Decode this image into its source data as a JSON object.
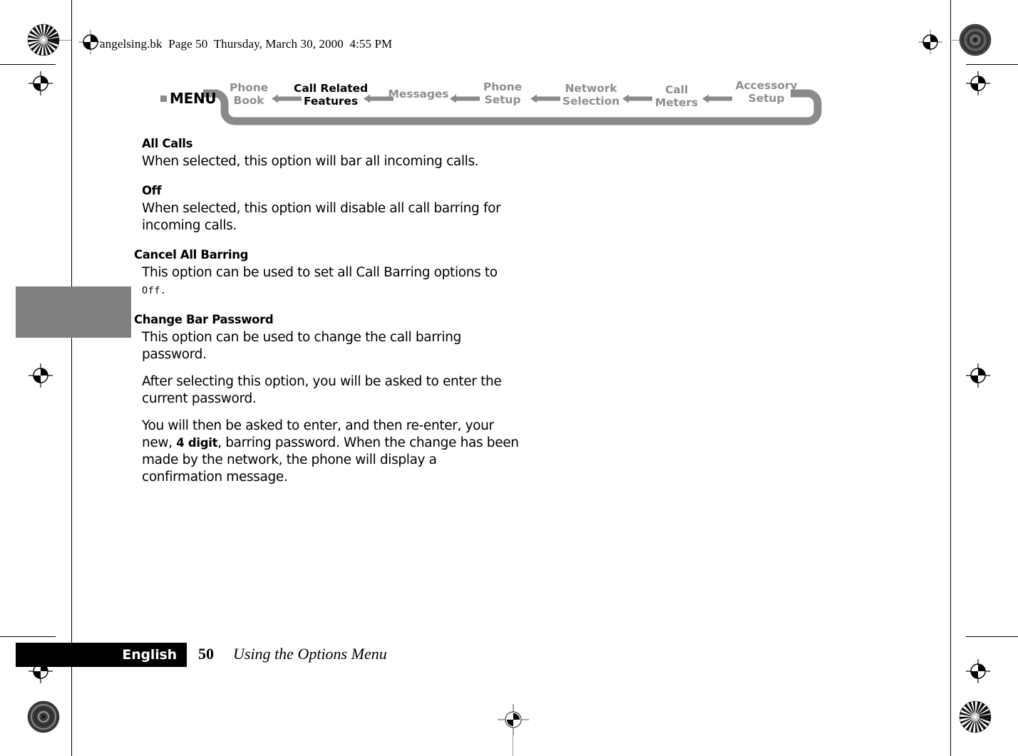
{
  "document": {
    "header_line": "angelsing.bk  Page 50  Thursday, March 30, 2000  4:55 PM"
  },
  "breadcrumb": {
    "menu_label": "MENU",
    "items": [
      {
        "line1": "Phone",
        "line2": "Book",
        "active": false
      },
      {
        "line1": "Call Related",
        "line2": "Features",
        "active": true
      },
      {
        "line1": "Messages",
        "line2": "",
        "active": false
      },
      {
        "line1": "Phone",
        "line2": "Setup",
        "active": false
      },
      {
        "line1": "Network",
        "line2": "Selection",
        "active": false
      },
      {
        "line1": "Call",
        "line2": "Meters",
        "active": false
      },
      {
        "line1": "Accessory",
        "line2": "Setup",
        "active": false
      }
    ]
  },
  "content": {
    "all_calls_heading": "All Calls",
    "all_calls_body": "When selected, this option will bar all incoming calls.",
    "off_heading": "Off",
    "off_body": "When selected, this option will disable all call barring for incoming calls.",
    "cancel_all_barring_heading": "Cancel All Barring",
    "cancel_all_barring_body_prefix": "This option can be used to set all Call Barring options to ",
    "cancel_all_barring_body_device": "Off",
    "cancel_all_barring_body_suffix": ".",
    "change_bar_password_heading": "Change Bar Password",
    "change_bar_password_body": "This option can be used to change the call barring password.",
    "change_bar_password_para2": "After selecting this option, you will be asked to enter the current password.",
    "change_bar_password_para3_prefix": "You will then be asked to enter, and then re-enter, your new, ",
    "change_bar_password_para3_bold": "4 digit",
    "change_bar_password_para3_suffix": ", barring password. When the change has been made by the network, the phone will display a confirmation message."
  },
  "footer": {
    "language": "English",
    "page_number": "50",
    "section_title": "Using the Options Menu"
  },
  "colors": {
    "nav_inactive": "#8e8e8e",
    "nav_active": "#000000",
    "nav_track": "#8a8a8a",
    "thumb_tab": "#808080",
    "footer_bar": "#000000"
  }
}
